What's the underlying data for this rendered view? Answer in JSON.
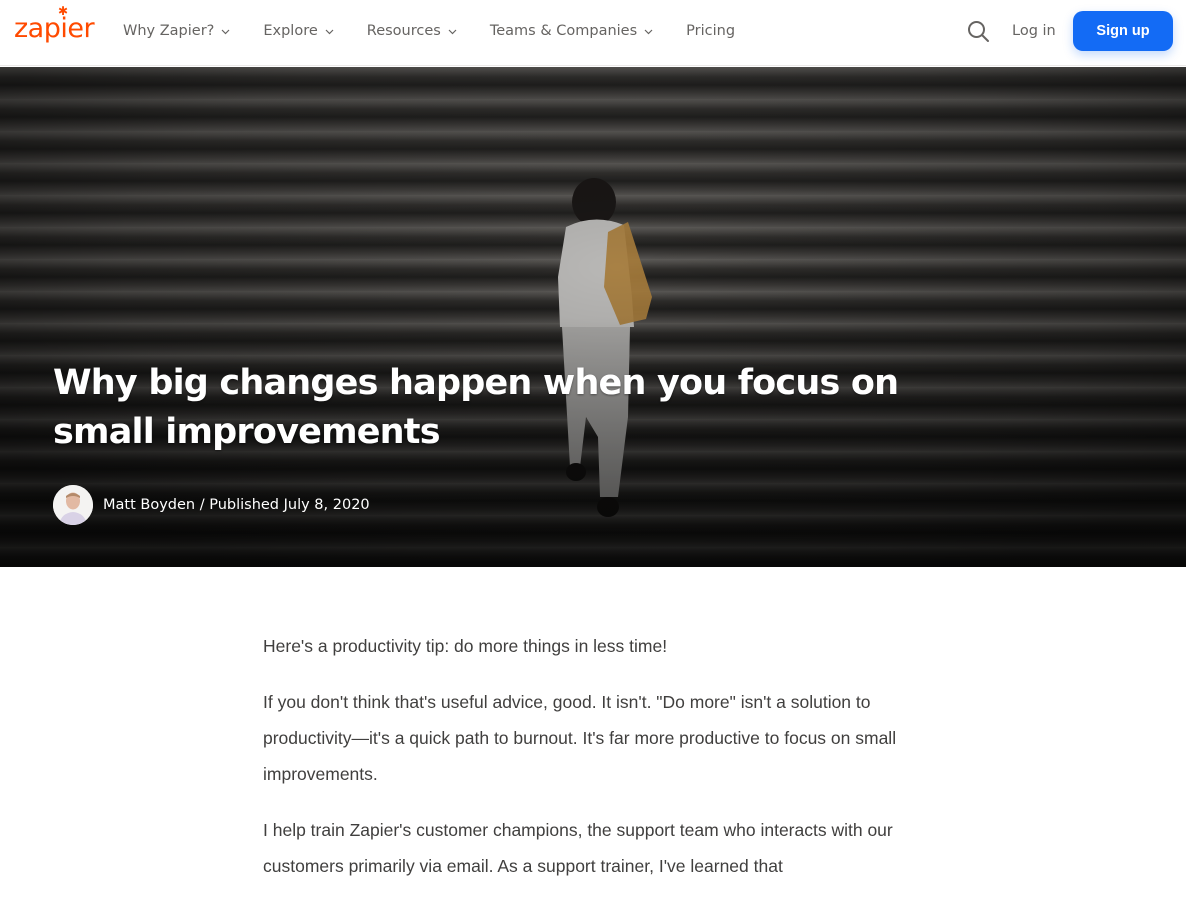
{
  "header": {
    "logo_text": "zapier",
    "nav": [
      {
        "label": "Why Zapier?",
        "has_dropdown": true
      },
      {
        "label": "Explore",
        "has_dropdown": true
      },
      {
        "label": "Resources",
        "has_dropdown": true
      },
      {
        "label": "Teams & Companies",
        "has_dropdown": true
      },
      {
        "label": "Pricing",
        "has_dropdown": false
      }
    ],
    "search_icon": "search-icon",
    "login_label": "Log in",
    "signup_label": "Sign up"
  },
  "hero": {
    "title": "Why big changes happen when you focus on small improvements",
    "author": "Matt Boyden",
    "separator": " / ",
    "published": "Published July 8, 2020"
  },
  "article": {
    "paragraphs": [
      "Here's a productivity tip: do more things in less time!",
      "If you don't think that's useful advice, good. It isn't. \"Do more\" isn't a solution to productivity—it's a quick path to burnout. It's far more productive to focus on small improvements.",
      "I help train Zapier's customer champions, the support team who interacts with our customers primarily via email. As a support trainer, I've learned that"
    ]
  },
  "colors": {
    "brand_orange": "#ff4a00",
    "signup_blue": "#136bf5",
    "nav_text": "#666462",
    "body_text": "#403f3e"
  }
}
